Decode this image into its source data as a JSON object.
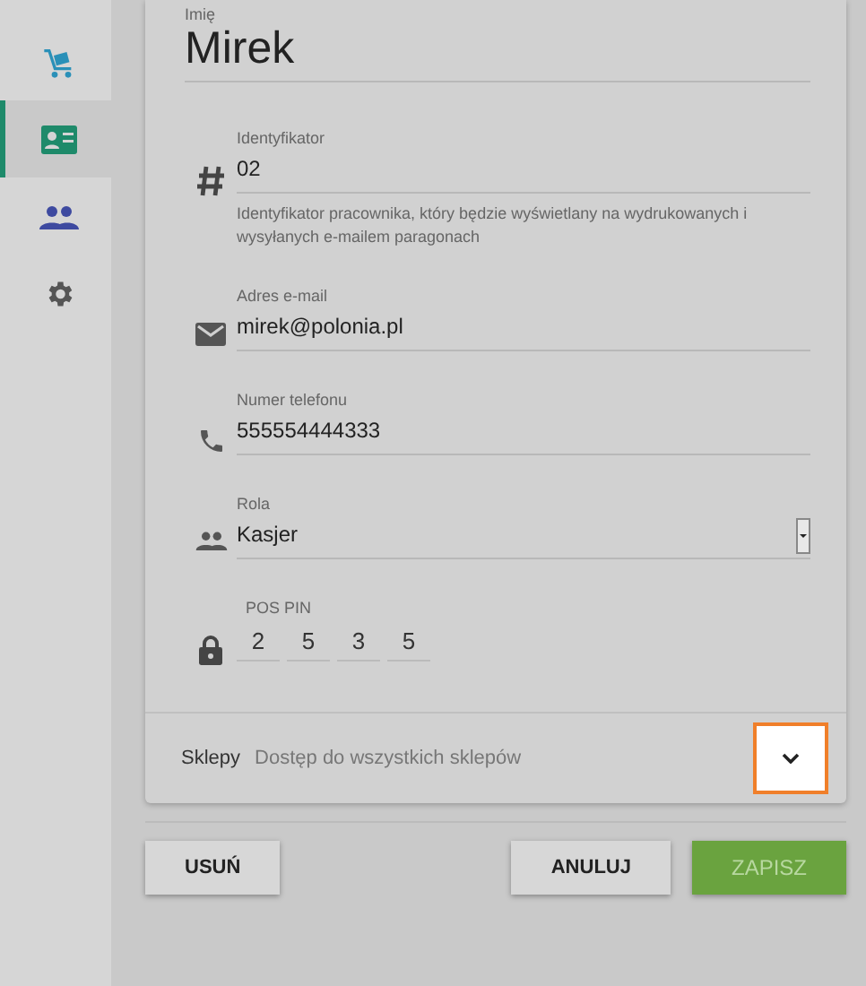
{
  "sidebar": {
    "items": [
      {
        "selected": false
      },
      {
        "selected": true
      },
      {
        "selected": false
      },
      {
        "selected": false
      }
    ]
  },
  "name_field": {
    "label": "Imię",
    "value": "Mirek"
  },
  "fields": [
    {
      "kind": "text",
      "label": "Identyfikator",
      "value": "02",
      "help": "Identyfikator pracownika, który będzie wyświetlany na wydrukowanych i wysyłanych e-mailem paragonach"
    },
    {
      "kind": "text",
      "label": "Adres e-mail",
      "value": "mirek@polonia.pl"
    },
    {
      "kind": "text",
      "label": "Numer telefonu",
      "value": "555554444333"
    },
    {
      "kind": "select",
      "label": "Rola",
      "value": "Kasjer"
    },
    {
      "kind": "pin",
      "label": "POS PIN",
      "digits": [
        "2",
        "5",
        "3",
        "5"
      ]
    }
  ],
  "stores": {
    "label": "Sklepy",
    "value": "Dostęp do wszystkich sklepów",
    "expanded": false
  },
  "buttons": {
    "delete": "USUŃ",
    "cancel": "ANULUJ",
    "save": "ZAPISZ"
  }
}
